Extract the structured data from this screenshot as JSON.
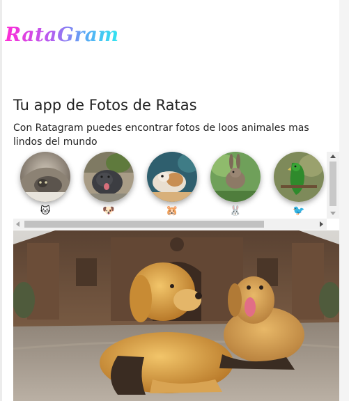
{
  "app": {
    "logo": "RataGram"
  },
  "intro": {
    "heading": "Tu app de Fotos de Ratas",
    "description": "Con Ratagram puedes encontrar fotos de loos animales mas lindos del mundo"
  },
  "stories": [
    {
      "animal": "cat",
      "emoji": "🐱"
    },
    {
      "animal": "dog",
      "emoji": "🐶"
    },
    {
      "animal": "hamster",
      "emoji": "🐹"
    },
    {
      "animal": "rabbit",
      "emoji": "🐰"
    },
    {
      "animal": "bird",
      "emoji": "🐦"
    }
  ],
  "feed": {
    "photo_subject": "two golden retriever dogs lying on a plaza in front of a cathedral"
  },
  "colors": {
    "logo_gradient": [
      "#ff2bd6",
      "#b45cf0",
      "#5aa8f5",
      "#2fe6f0"
    ],
    "text": "#222222",
    "scrollbar_track": "#f1f1f1",
    "scrollbar_thumb": "#c1c1c1"
  }
}
